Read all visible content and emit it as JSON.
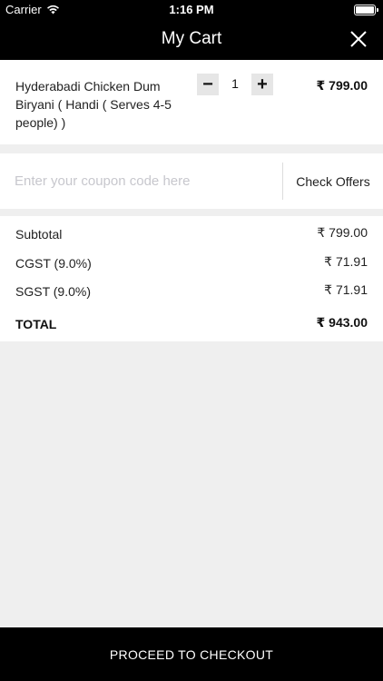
{
  "status_bar": {
    "carrier": "Carrier",
    "time": "1:16 PM"
  },
  "nav": {
    "title": "My Cart"
  },
  "cart_item": {
    "name": "Hyderabadi Chicken Dum Biryani ( Handi ( Serves 4-5 people) )",
    "quantity": "1",
    "price": "₹ 799.00",
    "minus": "−",
    "plus": "+"
  },
  "coupon": {
    "placeholder": "Enter your coupon code here",
    "value": "",
    "button": "Check Offers"
  },
  "summary": {
    "subtotal_label": "Subtotal",
    "subtotal_value": "₹ 799.00",
    "cgst_label": "CGST (9.0%)",
    "cgst_value": "₹ 71.91",
    "sgst_label": "SGST (9.0%)",
    "sgst_value": "₹ 71.91",
    "total_label": "TOTAL",
    "total_value": "₹ 943.00"
  },
  "checkout": {
    "label": "PROCEED TO CHECKOUT"
  },
  "colors": {
    "bar": "#000000",
    "surface": "#ffffff",
    "background": "#efefef",
    "placeholder": "#c7c7cd"
  },
  "icons": [
    "wifi-icon",
    "battery-icon",
    "close-icon"
  ]
}
